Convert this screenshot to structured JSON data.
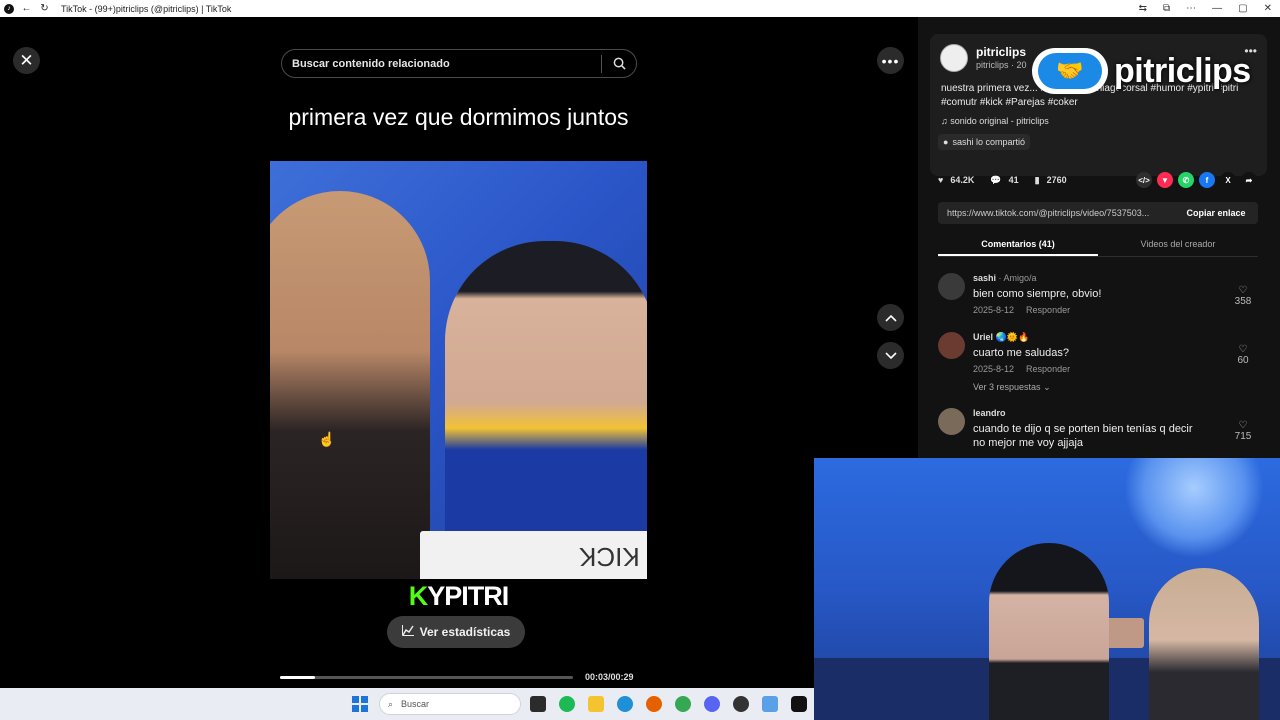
{
  "window": {
    "title": "TikTok - (99+)pitriclips (@pitriclips) | TikTok"
  },
  "player": {
    "search_placeholder": "Buscar contenido relacionado",
    "caption": "primera vez que dormimos juntos",
    "sign_text": "KICK",
    "brand_k": "K",
    "brand_rest": "YPITRI",
    "stats_label": "Ver estadísticas",
    "time": "00:03/00:29",
    "progress": 0.12
  },
  "post": {
    "author": "pitriclips",
    "author_sub": "pitriclips · 20",
    "description": "nuestra primera vez... #streamer #thiagocorsal #humor #ypitri #pitri #comutr #kick #Parejas #coker",
    "music": "sonido original - pitriclips",
    "shared": "sashi lo compartió",
    "likes": "64.2K",
    "comments": "41",
    "saves": "2760",
    "link": "https://www.tiktok.com/@pitriclips/video/7537503...",
    "copy_label": "Copiar enlace"
  },
  "tabs": [
    {
      "label": "Comentarios (41)"
    },
    {
      "label": "Videos del creador"
    }
  ],
  "comments": [
    {
      "name": "sashi",
      "tag": "· Amigo/a",
      "text": "bien como siempre, obvio!",
      "date": "2025-8-12",
      "reply": "Responder",
      "likes": "358"
    },
    {
      "name": "Uriel",
      "tag": "",
      "text": "cuarto me saludas?",
      "date": "2025-8-12",
      "reply": "Responder",
      "likes": "60",
      "replies": "Ver 3 respuestas"
    },
    {
      "name": "leandro",
      "tag": "",
      "text": "cuando te dijo q se porten bien tenías q decir no mejor me voy ajjaja",
      "date": "",
      "reply": "",
      "likes": "715"
    }
  ],
  "overlay": {
    "logo_text": "pitriclips"
  },
  "taskbar": {
    "search_label": "Buscar"
  },
  "colors": {
    "accent_green": "#53fc18",
    "like": "#fe2c55"
  }
}
